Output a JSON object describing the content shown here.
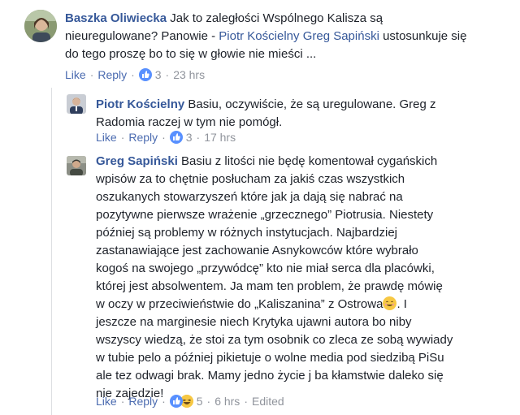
{
  "comments": [
    {
      "author": "Baszka Oliwiecka",
      "lines": [
        "Jak to zaległości Wspólnego Kalisza są",
        "nieuregulowane? Panowie - ",
        "do tego proszę bo to się w głowie nie mieści ..."
      ],
      "mention1": "Piotr Kościelny",
      "mention2": "Greg Sapiński",
      "after_mentions": " ustosunkuje się",
      "like": "Like",
      "reply": "Reply",
      "reaction_count": "3",
      "time": "23 hrs"
    },
    {
      "author": "Piotr Kościelny",
      "lines": [
        "Basiu, oczywiście, że są uregulowane. Greg z",
        "Radomia raczej w tym nie pomógł."
      ],
      "like": "Like",
      "reply": "Reply",
      "reaction_count": "3",
      "time": "17 hrs"
    },
    {
      "author": "Greg Sapiński",
      "lines": [
        "Basiu z litości nie będę komentował cygańskich",
        "wpisów za to chętnie posłucham za jakiś czas wszystkich",
        "oszukanych stowarzyszeń które jak ja dają się nabrać na",
        "pozytywne pierwsze wrażenie „grzecznego” Piotrusia. Niestety",
        "później są problemy w różnych instytucjach. Najbardziej",
        "zastanawiające jest zachowanie Asnykowców które wybrało",
        "kogoś na swojego „przywódcę” kto nie miał serca dla placówki,",
        "której jest absolwentem. Ja mam ten problem, że prawdę mówię",
        "w oczy w przeciwieństwie do „Kaliszanina” z Ostrowa",
        "jeszcze na marginesie niech Krytyka ujawni autora bo niby",
        "wszyscy wiedzą, że stoi za tym osobnik co zleca ze sobą wywiady",
        "w tubie pelo a później pikietuje o wolne media pod siedzibą PiSu",
        "ale tez odwagi brak. Mamy jedno życie j ba kłamstwie daleko się",
        "nie zajedzie!"
      ],
      "line9_tail": ". I",
      "like": "Like",
      "reply": "Reply",
      "reaction_count": "5",
      "time": "6 hrs",
      "edited": "Edited"
    }
  ],
  "colors": {
    "link": "#365899",
    "action_link": "#4b6bb0",
    "meta": "#90949c",
    "like_blue": "#5890ff"
  }
}
